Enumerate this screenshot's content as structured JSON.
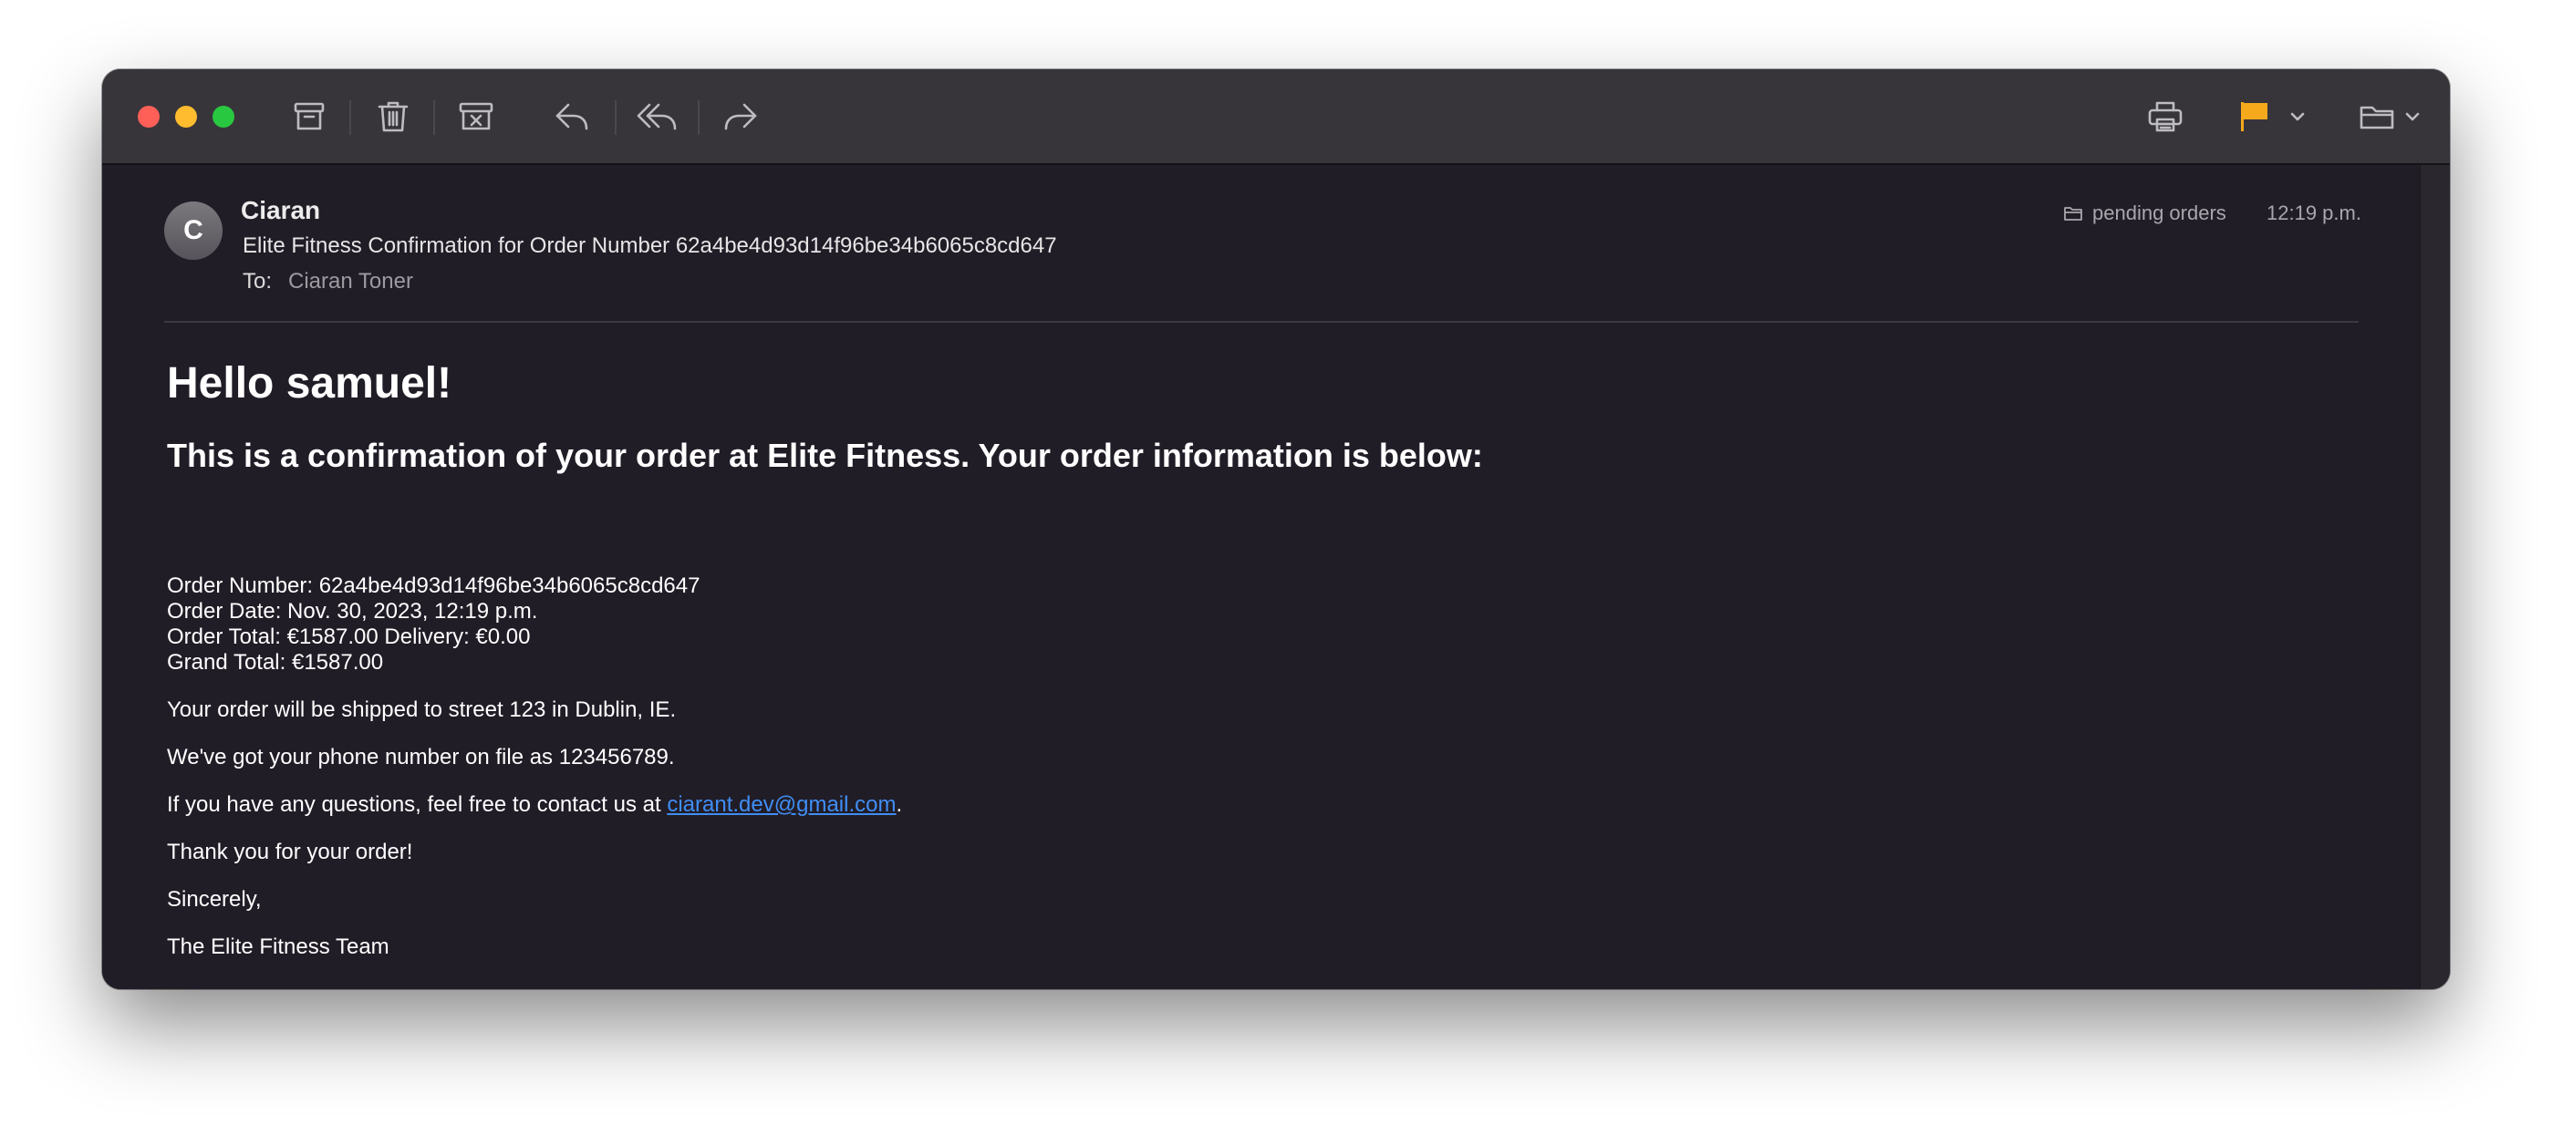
{
  "toolbar": {
    "buttons": [
      "archive-icon",
      "trash-icon",
      "junk-icon",
      "reply-icon",
      "reply-all-icon",
      "forward-icon",
      "print-icon",
      "flag-icon",
      "chevron-down-icon",
      "folder-icon"
    ],
    "flag_color": "#f6a91b"
  },
  "message": {
    "avatar_initial": "C",
    "sender": "Ciaran",
    "subject": "Elite Fitness Confirmation for Order Number 62a4be4d93d14f96be34b6065c8cd647",
    "to_label": "To:",
    "to_name": "Ciaran Toner",
    "mailbox": "pending orders",
    "time": "12:19 p.m."
  },
  "email": {
    "greeting": "Hello samuel!",
    "confirmation": "This is a confirmation of your order at Elite Fitness. Your order information is below:",
    "order_number": "Order Number: 62a4be4d93d14f96be34b6065c8cd647",
    "order_date": "Order Date: Nov. 30, 2023, 12:19 p.m.",
    "order_total": "Order Total: €1587.00 Delivery: €0.00",
    "grand_total": "Grand Total: €1587.00",
    "shipping": "Your order will be shipped to street 123 in Dublin, IE.",
    "phone": "We've got your phone number on file as 123456789.",
    "questions_prefix": "If you have any questions, feel free to contact us at ",
    "contact_email": "ciarant.dev@gmail.com",
    "questions_suffix": ".",
    "thanks": "Thank you for your order!",
    "sincerely": "Sincerely,",
    "signature": "The Elite Fitness Team"
  }
}
